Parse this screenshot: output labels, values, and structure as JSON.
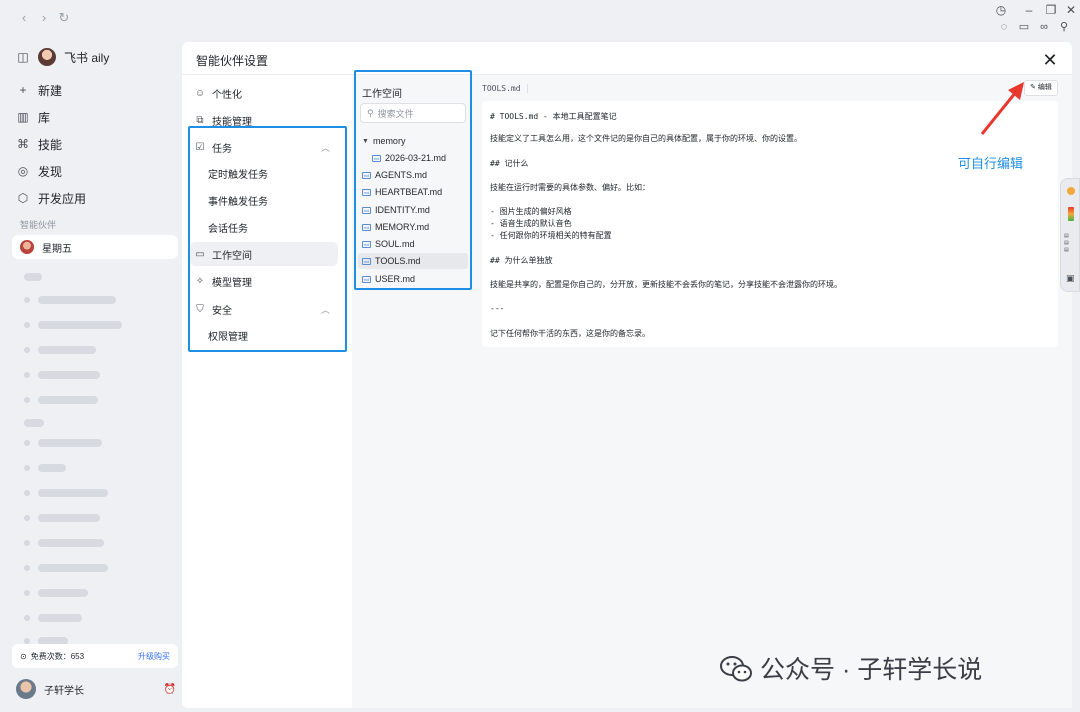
{
  "window": {
    "nav_back": "‹",
    "nav_forward": "›",
    "nav_refresh": "↻"
  },
  "sidebar": {
    "app_name": "飞书 aily",
    "items": [
      {
        "icon": "plus-icon",
        "glyph": "+",
        "label": "新建"
      },
      {
        "icon": "library-icon",
        "glyph": "▥",
        "label": "库"
      },
      {
        "icon": "skill-icon",
        "glyph": "⌘",
        "label": "技能"
      },
      {
        "icon": "discover-icon",
        "glyph": "◎",
        "label": "发现"
      },
      {
        "icon": "app-dev-icon",
        "glyph": "⬡",
        "label": "开发应用"
      }
    ],
    "partner_section_label": "智能伙伴",
    "partner_name": "星期五",
    "quota_label": "免费次数：653",
    "upgrade_label": "升级购买",
    "user_name": "子轩学长"
  },
  "dialog": {
    "title": "智能伙伴设置",
    "close_glyph": "✕",
    "nav": [
      {
        "key": "personalize",
        "label": "个性化",
        "glyph": "☺",
        "type": "top"
      },
      {
        "key": "skills",
        "label": "技能管理",
        "glyph": "⧉",
        "type": "top"
      },
      {
        "key": "tasks",
        "label": "任务",
        "glyph": "☑",
        "type": "group"
      },
      {
        "key": "timed",
        "label": "定时触发任务",
        "type": "sub"
      },
      {
        "key": "event",
        "label": "事件触发任务",
        "type": "sub"
      },
      {
        "key": "session",
        "label": "会话任务",
        "type": "sub"
      },
      {
        "key": "workspace",
        "label": "工作空间",
        "glyph": "▭",
        "type": "top",
        "active": true
      },
      {
        "key": "model",
        "label": "模型管理",
        "glyph": "✧",
        "type": "top"
      },
      {
        "key": "security",
        "label": "安全",
        "glyph": "⛉",
        "type": "group"
      },
      {
        "key": "permission",
        "label": "权限管理",
        "type": "sub"
      }
    ],
    "file_panel": {
      "title": "工作空间",
      "search_placeholder": "搜索文件",
      "folder": "memory",
      "files": [
        {
          "name": "2026-03-21.md",
          "nested": true
        },
        {
          "name": "AGENTS.md"
        },
        {
          "name": "HEARTBEAT.md"
        },
        {
          "name": "IDENTITY.md"
        },
        {
          "name": "MEMORY.md"
        },
        {
          "name": "SOUL.md"
        },
        {
          "name": "TOOLS.md",
          "active": true
        },
        {
          "name": "USER.md"
        }
      ]
    },
    "content": {
      "filename": "TOOLS.md",
      "edit_label": "编辑",
      "lines": [
        "# TOOLS.md - 本地工具配置笔记",
        "技能定义了工具怎么用，这个文件记的是你自己的具体配置，属于你的环境、你的设置。",
        "## 记什么",
        "技能在运行时需要的具体参数、偏好。比如：",
        "- 图片生成的偏好风格",
        "- 语音生成的默认音色",
        "- 任何跟你的环境相关的特有配置",
        "## 为什么单独放",
        "技能是共享的，配置是你自己的，分开放，更新技能不会丢你的笔记，分享技能不会泄露你的环境。",
        "---",
        "记下任何帮你干活的东西，这是你的备忘录。"
      ]
    }
  },
  "annotation": {
    "text": "可自行编辑",
    "color": "#1f8fe5"
  },
  "watermark": {
    "text": "公众号 · 子轩学长说"
  }
}
